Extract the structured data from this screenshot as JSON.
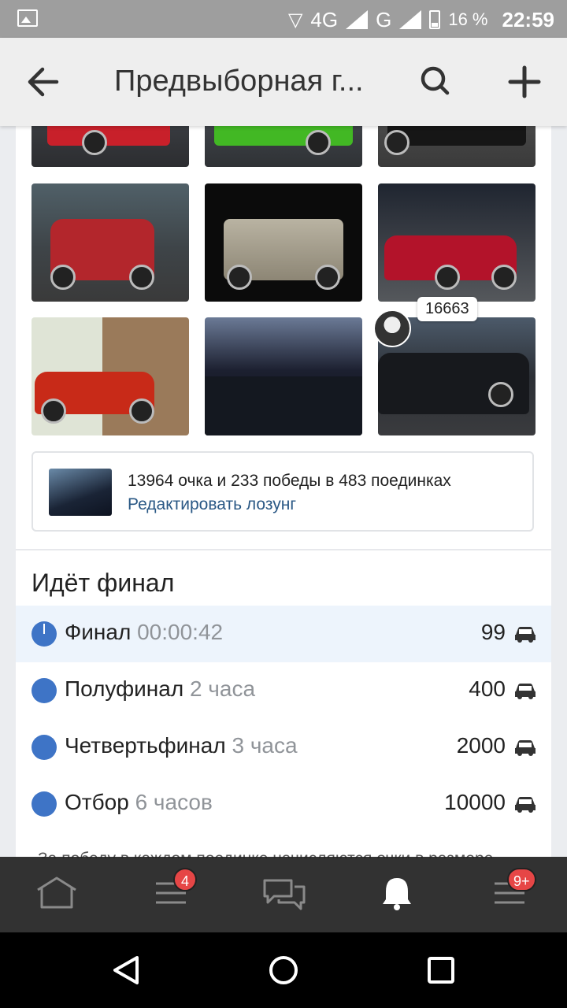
{
  "status_bar": {
    "network": "4G",
    "network2": "G",
    "battery": "16 %",
    "time": "22:59"
  },
  "app_bar": {
    "title": "Предвыборная г...",
    "back_icon": "arrow-left-icon",
    "search_icon": "search-icon",
    "add_icon": "plus-icon"
  },
  "gallery": {
    "photos": [
      {
        "name": "photo-red-sportscar"
      },
      {
        "name": "photo-green-sportscar"
      },
      {
        "name": "photo-black-car"
      },
      {
        "name": "photo-red-hatchback"
      },
      {
        "name": "photo-silver-mercedes"
      },
      {
        "name": "photo-red-subaru"
      },
      {
        "name": "photo-red-supercar"
      },
      {
        "name": "photo-volga-hood-ornament"
      },
      {
        "name": "photo-black-volga"
      }
    ],
    "score_badge": "16663"
  },
  "motto": {
    "stats": "13964 очка и 233 победы в 483 поединках",
    "edit_link": "Редактировать лозунг"
  },
  "stages": {
    "title": "Идёт финал",
    "items": [
      {
        "label": "Финал",
        "sub": "00:00:42",
        "count": "99"
      },
      {
        "label": "Полуфинал",
        "sub": "2 часа",
        "count": "400"
      },
      {
        "label": "Четвертьфинал",
        "sub": "3 часа",
        "count": "2000"
      },
      {
        "label": "Отбор",
        "sub": "6 часов",
        "count": "10000"
      }
    ]
  },
  "rules_text": "За победу в каждом поединке начисляются очки в размере уровня драйва соперника. Каждый этап очки обнуляются",
  "tab_bar": {
    "feed_badge": "4",
    "menu_badge": "9+"
  },
  "colors": {
    "accent": "#3e74c6",
    "link": "#2a5885",
    "badge": "#e64646"
  }
}
